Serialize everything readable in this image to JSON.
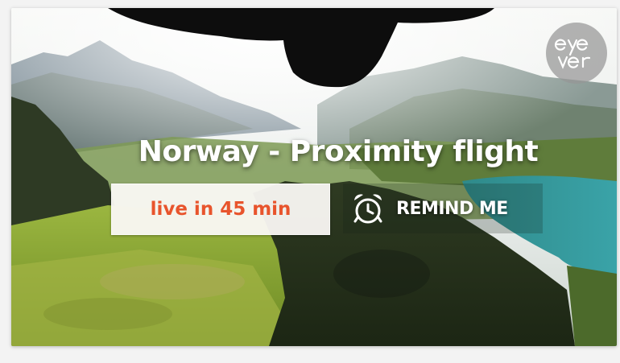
{
  "video": {
    "title": "Norway - Proximity flight",
    "status": "live in 45 min"
  },
  "actions": {
    "remind_label": "REMIND ME",
    "remind_icon": "alarm-clock-icon"
  },
  "brand": {
    "logo_icon": "eyever-logo",
    "logo_text": "eye ver"
  },
  "colors": {
    "status_text": "#e8542c",
    "title_text": "#ffffff",
    "badge_bg": "#faf8f4"
  }
}
